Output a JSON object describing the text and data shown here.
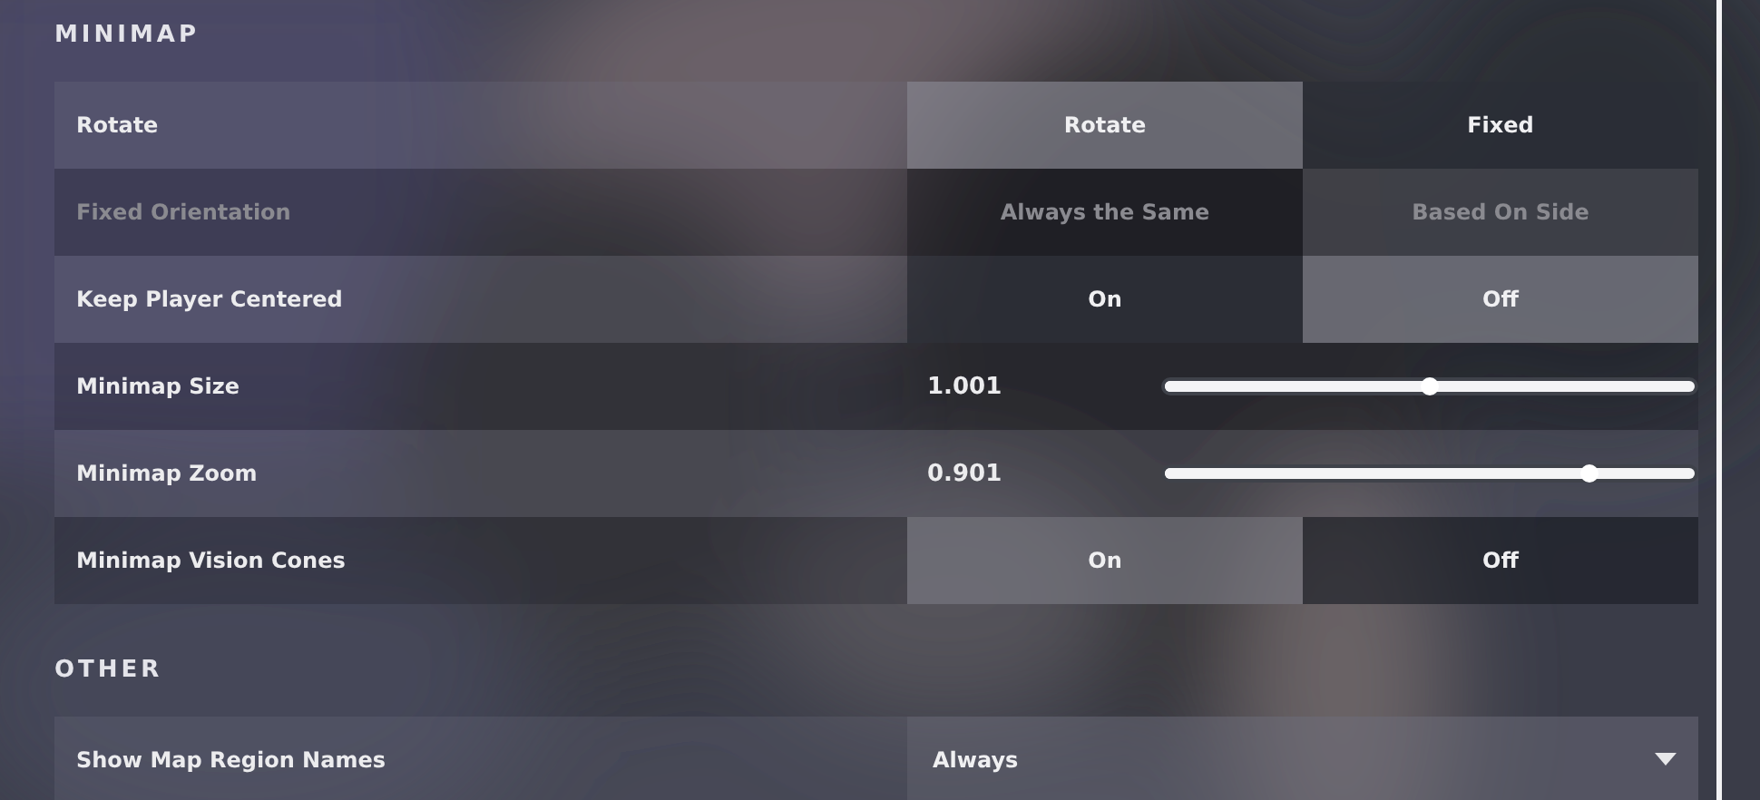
{
  "sections": [
    {
      "title": "MINIMAP",
      "rows": [
        {
          "kind": "toggle",
          "label": "Rotate",
          "disabled": false,
          "options": [
            {
              "label": "Rotate",
              "selected": true
            },
            {
              "label": "Fixed",
              "selected": false
            }
          ]
        },
        {
          "kind": "toggle",
          "label": "Fixed Orientation",
          "disabled": true,
          "options": [
            {
              "label": "Always the Same",
              "selected": false
            },
            {
              "label": "Based On Side",
              "selected": true
            }
          ]
        },
        {
          "kind": "toggle",
          "label": "Keep Player Centered",
          "disabled": false,
          "options": [
            {
              "label": "On",
              "selected": false
            },
            {
              "label": "Off",
              "selected": true
            }
          ]
        },
        {
          "kind": "slider",
          "label": "Minimap Size",
          "reading": "1.001",
          "level": 0.5
        },
        {
          "kind": "slider",
          "label": "Minimap Zoom",
          "reading": "0.901",
          "level": 0.8
        },
        {
          "kind": "toggle",
          "label": "Minimap Vision Cones",
          "disabled": false,
          "options": [
            {
              "label": "On",
              "selected": true
            },
            {
              "label": "Off",
              "selected": false
            }
          ]
        }
      ]
    },
    {
      "title": "OTHER",
      "rows": [
        {
          "kind": "dropdown",
          "label": "Show Map Region Names",
          "value": "Always"
        }
      ]
    }
  ]
}
